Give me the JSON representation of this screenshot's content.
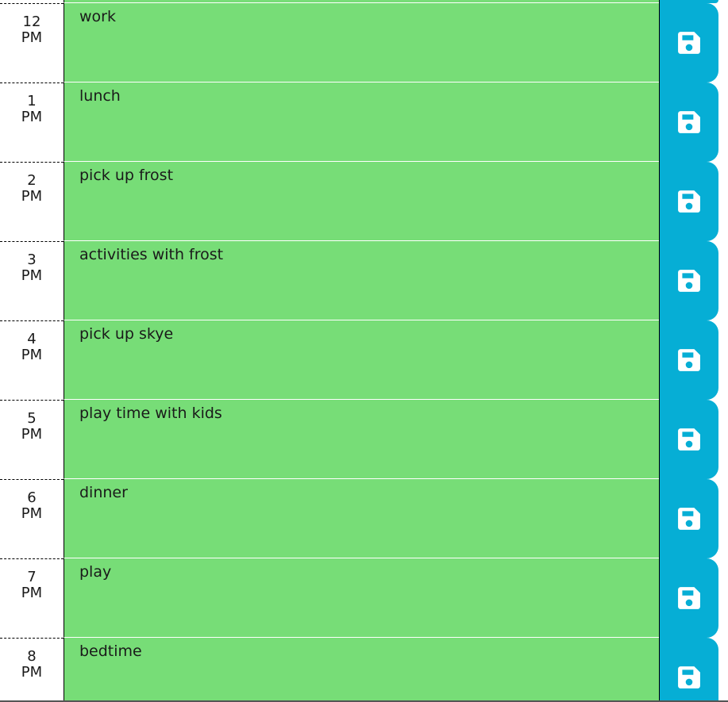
{
  "colors": {
    "present": "#77dd77",
    "save_button": "#06aed5",
    "save_icon": "#ffffff"
  },
  "icons": {
    "save": "floppy-disk"
  },
  "time_blocks": [
    {
      "hour": "12",
      "period": "PM",
      "description": "work"
    },
    {
      "hour": "1",
      "period": "PM",
      "description": "lunch"
    },
    {
      "hour": "2",
      "period": "PM",
      "description": "pick up frost"
    },
    {
      "hour": "3",
      "period": "PM",
      "description": "activities with frost"
    },
    {
      "hour": "4",
      "period": "PM",
      "description": "pick up skye"
    },
    {
      "hour": "5",
      "period": "PM",
      "description": "play time with kids"
    },
    {
      "hour": "6",
      "period": "PM",
      "description": "dinner"
    },
    {
      "hour": "7",
      "period": "PM",
      "description": "play"
    },
    {
      "hour": "8",
      "period": "PM",
      "description": "bedtime"
    }
  ]
}
